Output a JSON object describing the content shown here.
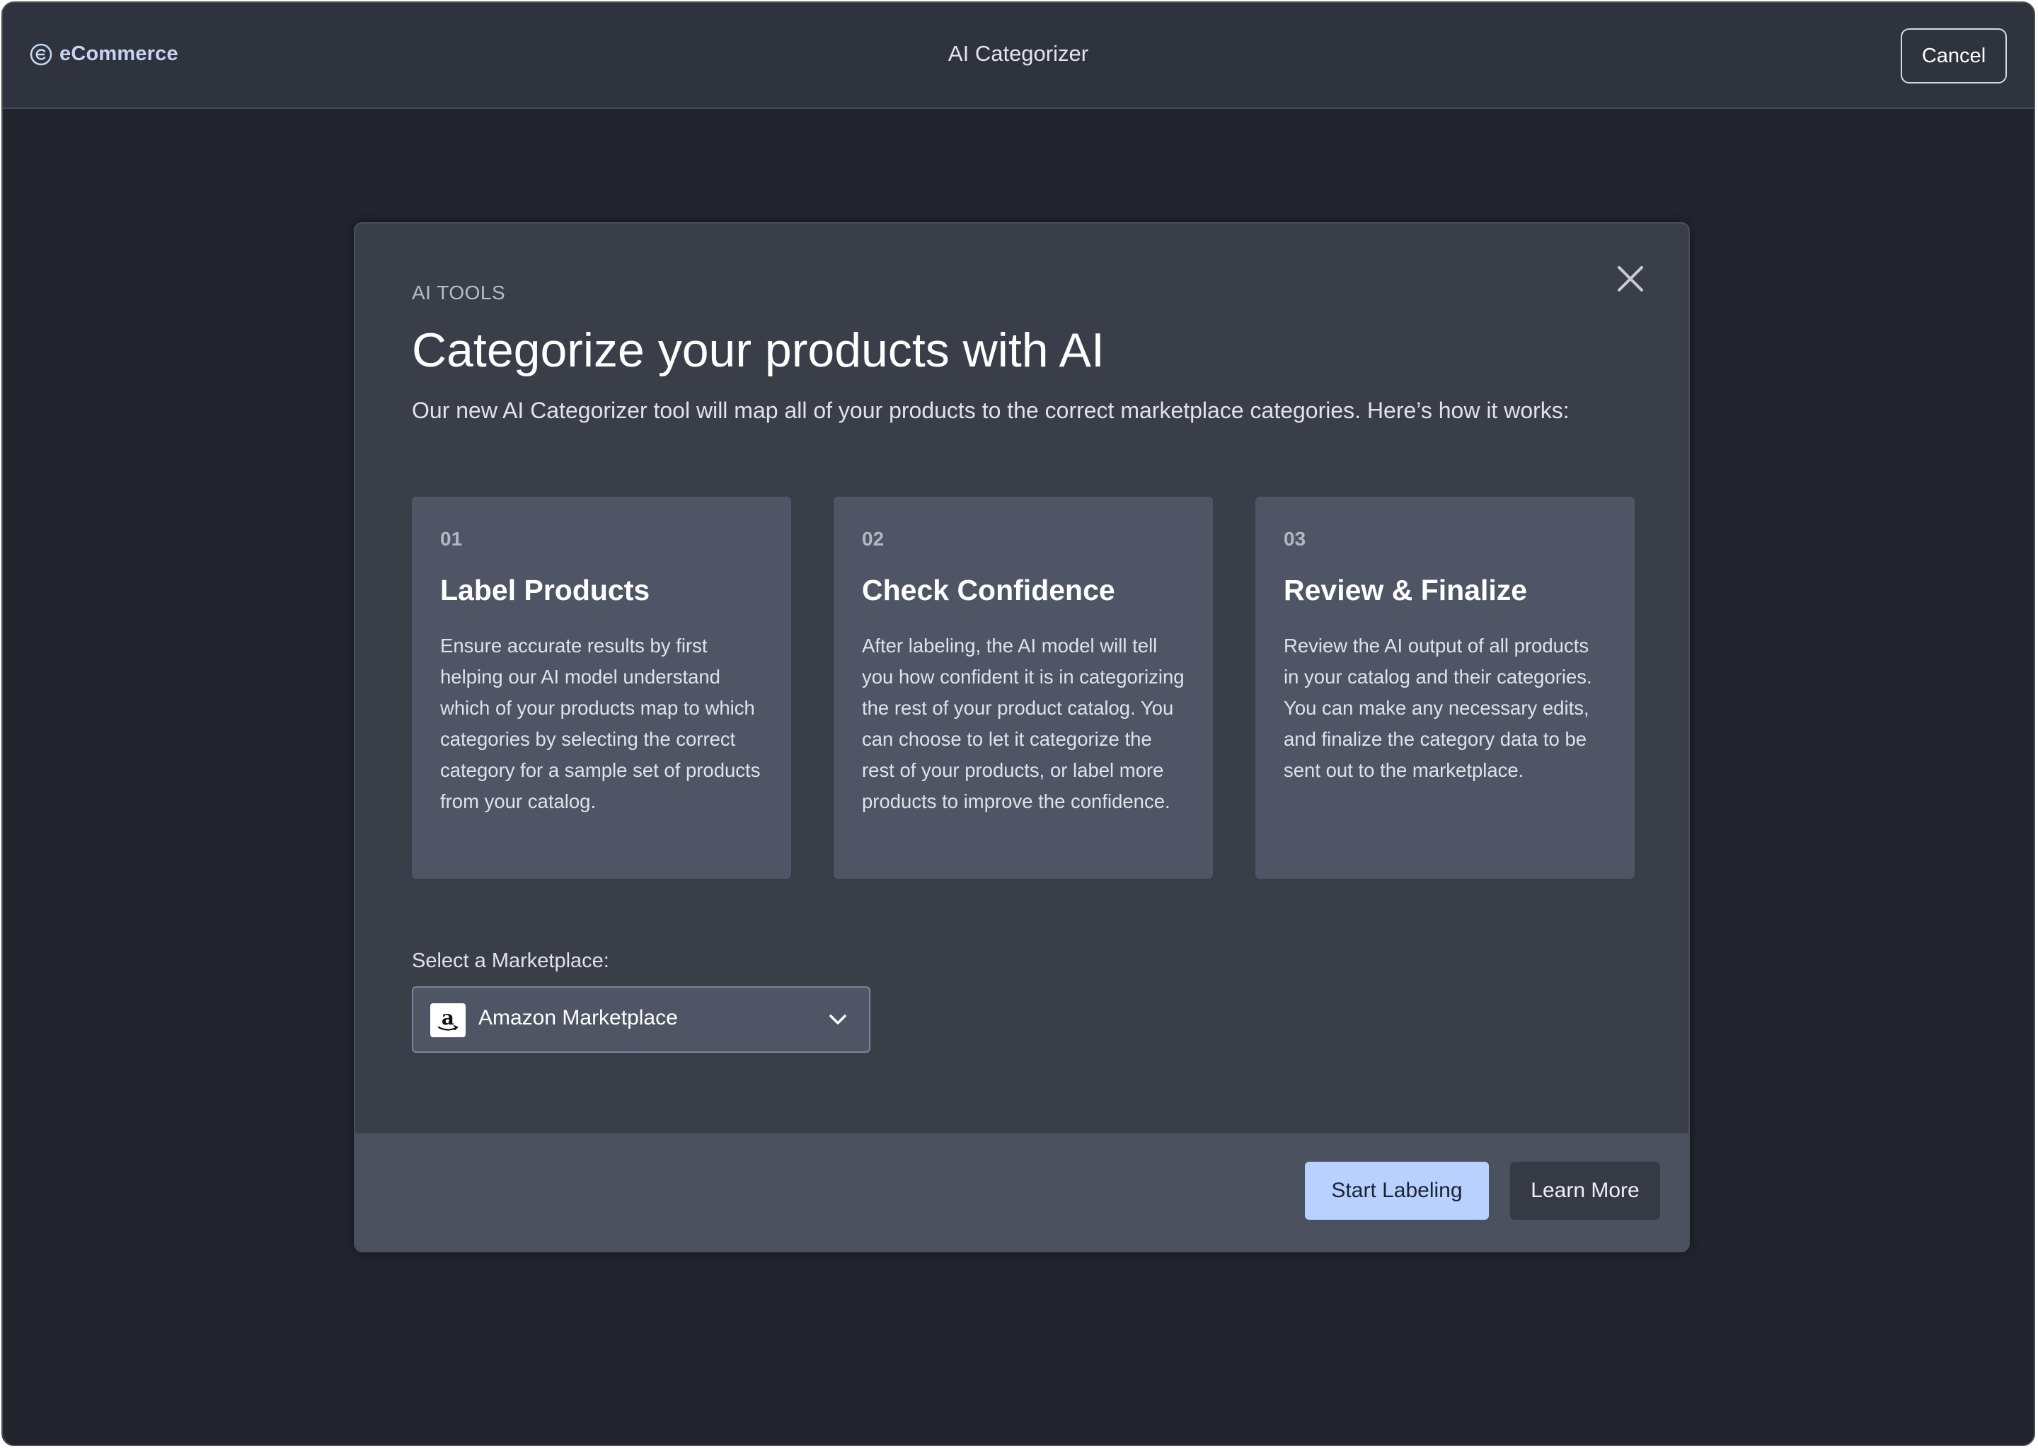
{
  "app": {
    "brand": "eCommerce",
    "title": "AI Categorizer",
    "cancel_label": "Cancel"
  },
  "modal": {
    "eyebrow": "AI TOOLS",
    "title": "Categorize your products with AI",
    "intro": "Our new AI Categorizer tool will map all of your products to the correct marketplace categories. Here’s how it works:",
    "steps": [
      {
        "number": "01",
        "title": "Label Products",
        "description": "Ensure accurate results by first helping our AI model understand which of your products map to which categories by selecting the correct category for a sample set of products from your catalog."
      },
      {
        "number": "02",
        "title": "Check Confidence",
        "description": "After labeling, the AI model will tell you how confident it is in categorizing the rest of your product catalog. You can choose to let it categorize the rest of your products, or label more products to improve the confidence."
      },
      {
        "number": "03",
        "title": "Review & Finalize",
        "description": "Review the AI output of all products in your catalog and their categories. You can make any necessary edits, and finalize the category data to be sent out to the marketplace."
      }
    ],
    "marketplace": {
      "label": "Select a Marketplace:",
      "selected": "Amazon Marketplace",
      "logo_letter": "a",
      "icon": "amazon-logo"
    },
    "footer": {
      "primary_label": "Start Labeling",
      "secondary_label": "Learn More"
    }
  },
  "colors": {
    "background": "#22252e",
    "topbar": "#2f333d",
    "modal": "#3a3e49",
    "card": "#4f5564",
    "primary_button": "#b8d1ff",
    "brand_text": "#c6d5f4"
  }
}
